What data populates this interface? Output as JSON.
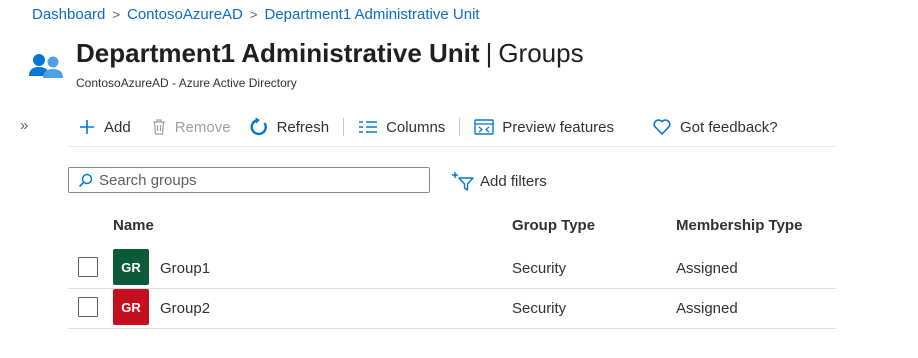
{
  "breadcrumb": [
    "Dashboard",
    "ContosoAzureAD",
    "Department1 Administrative Unit"
  ],
  "header": {
    "title": "Department1 Administrative Unit",
    "section": "Groups",
    "subtitle": "ContosoAzureAD - Azure Active Directory",
    "icon": "groups-icon"
  },
  "expand_label": "»",
  "toolbar": {
    "add": "Add",
    "remove": "Remove",
    "refresh": "Refresh",
    "columns": "Columns",
    "preview": "Preview features",
    "feedback": "Got feedback?"
  },
  "search": {
    "placeholder": "Search groups",
    "value": ""
  },
  "filters": {
    "label": "Add filters"
  },
  "table": {
    "columns": [
      "Name",
      "Group Type",
      "Membership Type"
    ],
    "rows": [
      {
        "initials": "GR",
        "name": "Group1",
        "type": "Security",
        "membership": "Assigned",
        "color": "#0b5a38"
      },
      {
        "initials": "GR",
        "name": "Group2",
        "type": "Security",
        "membership": "Assigned",
        "color": "#c50f1f"
      }
    ]
  },
  "colors": {
    "link": "#0b6cc9",
    "icon_blue": "#0078d4"
  }
}
